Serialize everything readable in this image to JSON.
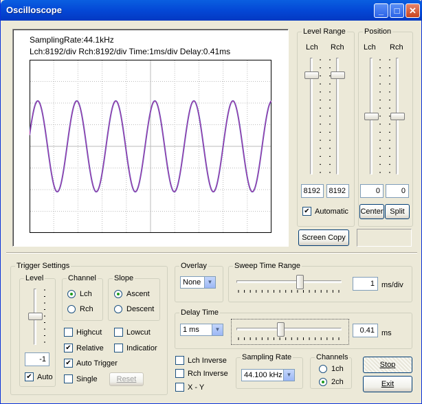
{
  "window": {
    "title": "Oscilloscope"
  },
  "title_buttons": {
    "minimize": "_",
    "maximize": "□",
    "close": "✕"
  },
  "scope": {
    "sampling_text": "SamplingRate:44.1kHz",
    "info_text": "Lch:8192/div  Rch:8192/div  Time:1ms/div  Delay:0.41ms",
    "wave_color": "#c0309a",
    "wave_color2": "#4466cc",
    "cycles": 6.2,
    "amplitude_div": 2.1
  },
  "level_range": {
    "title": "Level Range",
    "lch_label": "Lch",
    "rch_label": "Rch",
    "lch_value": "8192",
    "rch_value": "8192",
    "automatic_label": "Automatic",
    "automatic_checked": true
  },
  "position": {
    "title": "Position",
    "lch_label": "Lch",
    "rch_label": "Rch",
    "lch_value": "0",
    "rch_value": "0",
    "center_label": "Center",
    "split_label": "Split"
  },
  "screen_copy_label": "Screen Copy",
  "trigger": {
    "title": "Trigger Settings",
    "level": {
      "title": "Level",
      "value": "-1",
      "auto_label": "Auto",
      "auto_checked": true
    },
    "channel": {
      "title": "Channel",
      "lch": "Lch",
      "rch": "Rch",
      "selected": "Lch"
    },
    "slope": {
      "title": "Slope",
      "ascent": "Ascent",
      "descent": "Descent",
      "selected": "Ascent"
    },
    "highcut": "Highcut",
    "lowcut": "Lowcut",
    "relative": "Relative",
    "indication": "Indicatior",
    "auto_trigger": "Auto Trigger",
    "single": "Single",
    "reset": "Reset"
  },
  "overlay": {
    "title": "Overlay",
    "value": "None"
  },
  "sweep": {
    "title": "Sweep Time Range",
    "value": "1",
    "unit": "ms/div"
  },
  "delay": {
    "title": "Delay Time",
    "select_value": "1 ms",
    "value": "0.41",
    "unit": "ms"
  },
  "inverse": {
    "lch": "Lch Inverse",
    "rch": "Rch Inverse",
    "xy": "X - Y"
  },
  "sampling_rate": {
    "title": "Sampling Rate",
    "value": "44.100 kHz"
  },
  "channels": {
    "title": "Channels",
    "one": "1ch",
    "two": "2ch",
    "selected": "2ch"
  },
  "stop_label": "Stop",
  "exit_label": "Exit"
}
